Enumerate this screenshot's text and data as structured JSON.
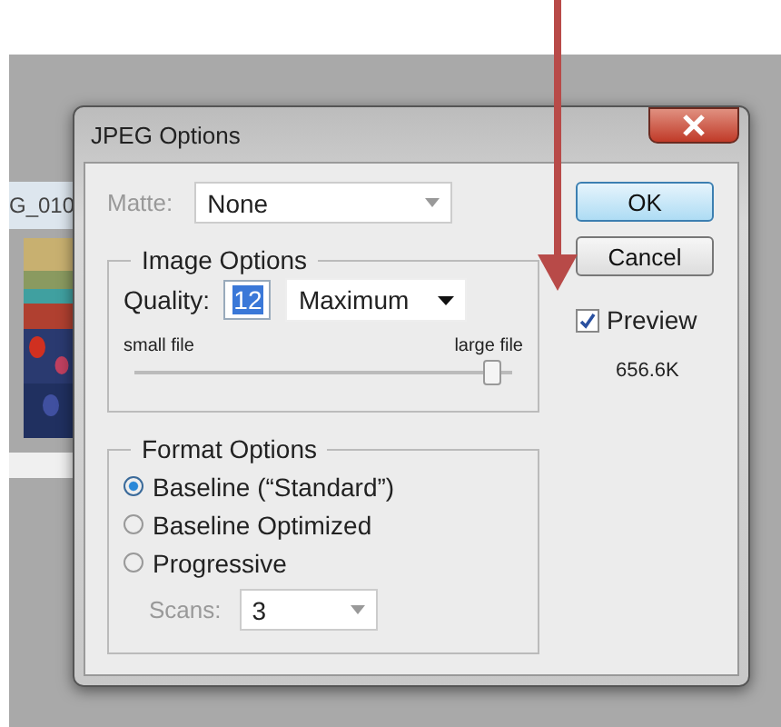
{
  "document": {
    "tab": "G_010"
  },
  "window": {
    "title": "JPEG Options"
  },
  "matte": {
    "label": "Matte:",
    "value": "None",
    "disabled": true
  },
  "image_options": {
    "title": "Image Options",
    "quality_label": "Quality:",
    "quality": "12",
    "preset": "Maximum",
    "min_label": "small file",
    "max_label": "large file",
    "level": 0.94
  },
  "format_options": {
    "title": "Format Options",
    "options": [
      {
        "label": "Baseline (“Standard”)",
        "selected": true
      },
      {
        "label": "Baseline Optimized",
        "selected": false
      },
      {
        "label": "Progressive",
        "selected": false
      }
    ],
    "scans": {
      "label": "Scans:",
      "value": "3",
      "disabled": true
    }
  },
  "buttons": [
    {
      "label": "OK",
      "default": true
    },
    {
      "label": "Cancel",
      "default": false
    }
  ],
  "preview": {
    "label": "Preview",
    "checked": true,
    "size": "656.6K"
  }
}
